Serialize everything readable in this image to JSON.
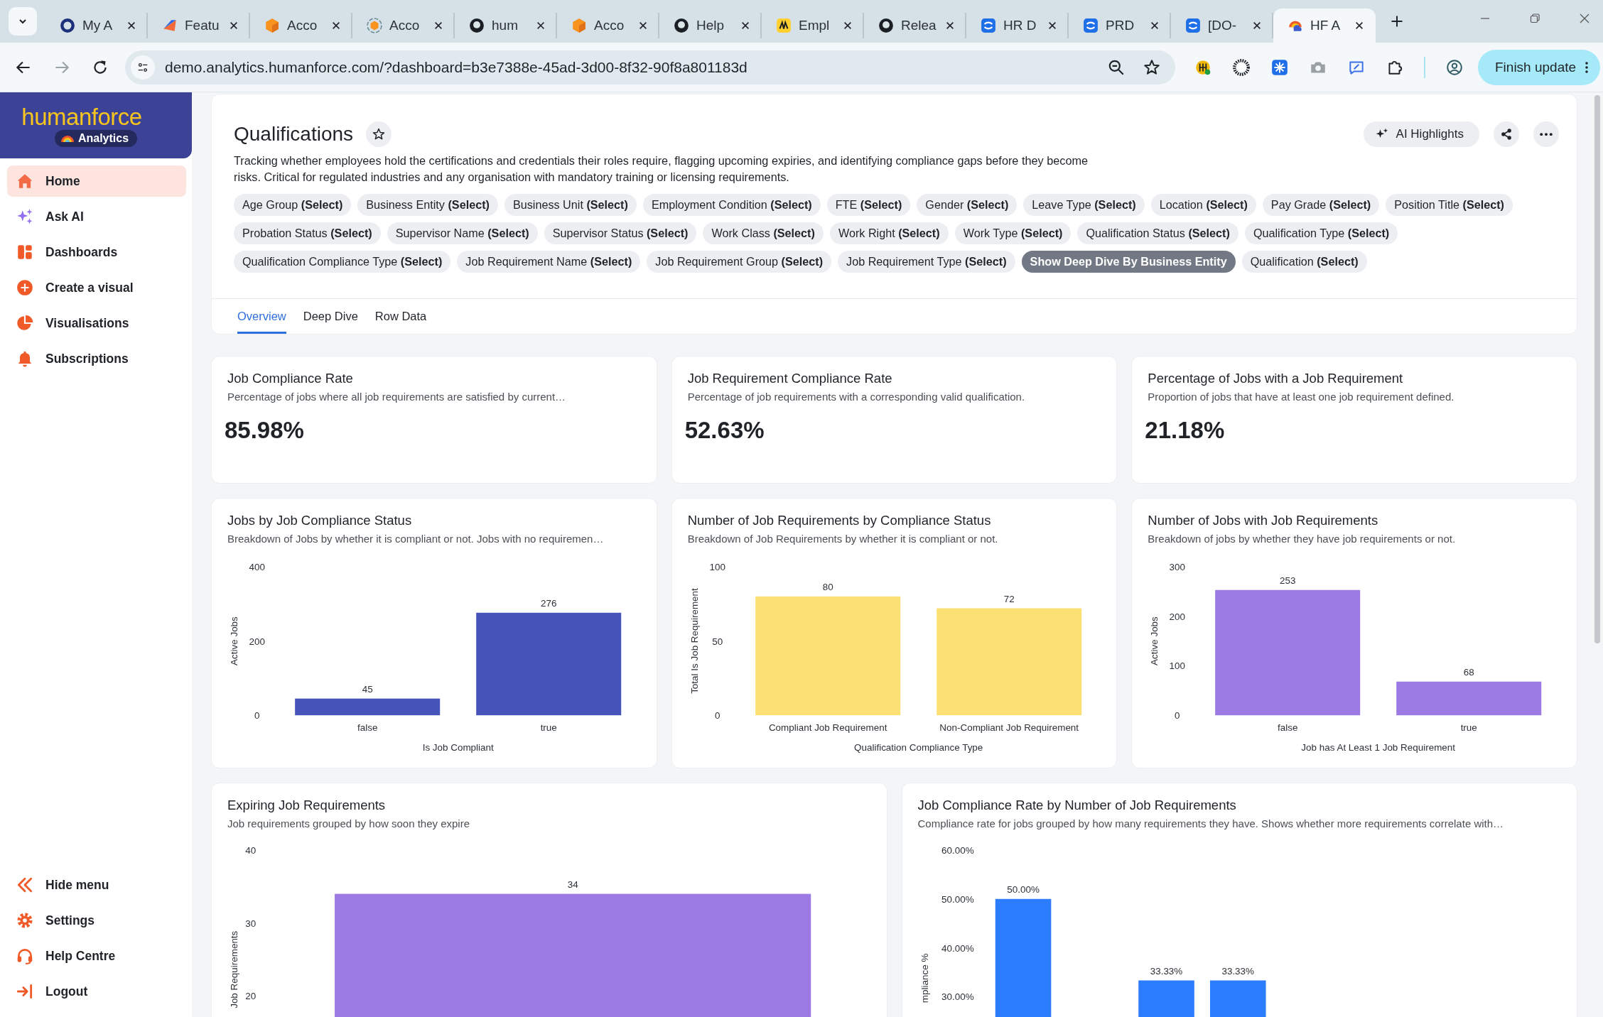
{
  "browser": {
    "tabs": [
      {
        "title": "My A",
        "selected": false
      },
      {
        "title": "Featu",
        "selected": false
      },
      {
        "title": "Acco",
        "selected": false
      },
      {
        "title": "Acco",
        "selected": false
      },
      {
        "title": "hum",
        "selected": false
      },
      {
        "title": "Acco",
        "selected": false
      },
      {
        "title": "Help",
        "selected": false
      },
      {
        "title": "Empl",
        "selected": false
      },
      {
        "title": "Relea",
        "selected": false
      },
      {
        "title": "HR D",
        "selected": false
      },
      {
        "title": "PRD",
        "selected": false
      },
      {
        "title": "[DO-",
        "selected": false
      },
      {
        "title": "HF A",
        "selected": true
      }
    ],
    "url": "demo.analytics.humanforce.com/?dashboard=b3e7388e-45ad-3d00-8f32-90f8a801183d",
    "update_button": "Finish update"
  },
  "sidebar": {
    "logo": {
      "wordmark": "humanforce",
      "badge": "Analytics"
    },
    "items": [
      {
        "label": "Home",
        "selected": true
      },
      {
        "label": "Ask AI",
        "selected": false
      },
      {
        "label": "Dashboards",
        "selected": false
      },
      {
        "label": "Create a visual",
        "selected": false
      },
      {
        "label": "Visualisations",
        "selected": false
      },
      {
        "label": "Subscriptions",
        "selected": false
      }
    ],
    "footer_items": [
      {
        "label": "Hide menu"
      },
      {
        "label": "Settings"
      },
      {
        "label": "Help Centre"
      },
      {
        "label": "Logout"
      }
    ]
  },
  "dashboard": {
    "title": "Qualifications",
    "description": "Tracking whether employees hold the certifications and credentials their roles require, flagging upcoming expiries, and identifying compliance gaps before they become risks. Critical for regulated industries and any organisation with mandatory training or licensing requirements.",
    "ai_button": "AI Highlights",
    "filter_rows": [
      [
        {
          "label": "Age Group **(Select)**",
          "selected": false
        },
        {
          "label": "Business Entity **(Select)**",
          "selected": false
        },
        {
          "label": "Business Unit **(Select)**",
          "selected": false
        },
        {
          "label": "Employment Condition **(Select)**",
          "selected": false
        },
        {
          "label": "FTE **(Select)**",
          "selected": false
        },
        {
          "label": "Gender **(Select)**",
          "selected": false
        },
        {
          "label": "Leave Type **(Select)**",
          "selected": false
        },
        {
          "label": "Location **(Select)**",
          "selected": false
        },
        {
          "label": "Pay Grade **(Select)**",
          "selected": false
        },
        {
          "label": "Position Title **(Select)**",
          "selected": false
        }
      ],
      [
        {
          "label": "Probation Status **(Select)**",
          "selected": false
        },
        {
          "label": "Supervisor Name **(Select)**",
          "selected": false
        },
        {
          "label": "Supervisor Status **(Select)**",
          "selected": false
        },
        {
          "label": "Work Class **(Select)**",
          "selected": false
        },
        {
          "label": "Work Right **(Select)**",
          "selected": false
        },
        {
          "label": "Work Type **(Select)**",
          "selected": false
        },
        {
          "label": "Qualification Status **(Select)**",
          "selected": false
        },
        {
          "label": "Qualification Type **(Select)**",
          "selected": false
        }
      ],
      [
        {
          "label": "Qualification Compliance Type **(Select)**",
          "selected": false
        },
        {
          "label": "Job Requirement Name **(Select)**",
          "selected": false
        },
        {
          "label": "Job Requirement Group **(Select)**",
          "selected": false
        },
        {
          "label": "Job Requirement Type **(Select)**",
          "selected": false
        },
        {
          "label": "Show Deep Dive By Business Entity",
          "selected": true
        },
        {
          "label": "Qualification **(Select)**",
          "selected": false
        }
      ]
    ],
    "tabs": [
      {
        "label": "Overview",
        "selected": true
      },
      {
        "label": "Deep Dive",
        "selected": false
      },
      {
        "label": "Row Data",
        "selected": false
      }
    ]
  },
  "kpis": [
    {
      "title": "Job Compliance Rate",
      "subtitle": "Percentage of jobs where all job requirements are satisfied by current…",
      "value": "85.98%"
    },
    {
      "title": "Job Requirement Compliance Rate",
      "subtitle": "Percentage of job requirements with a corresponding valid qualification.",
      "value": "52.63%"
    },
    {
      "title": "Percentage of Jobs with a Job Requirement",
      "subtitle": "Proportion of jobs that have at least one job requirement defined.",
      "value": "21.18%"
    }
  ],
  "charts": [
    {
      "title": "Jobs by Job Compliance Status",
      "subtitle": "Breakdown of Jobs by whether it is compliant or not. Jobs with no requiremen…",
      "chart_data": {
        "type": "bar",
        "xlabel": "Is Job Compliant",
        "ylabel": "Active Jobs",
        "categories": [
          "false",
          "true"
        ],
        "series": [
          {
            "color": "#4653b9",
            "values": [
              45,
              276
            ]
          }
        ],
        "ylim": [
          0,
          400
        ],
        "yticks": [
          0,
          200,
          400
        ],
        "data_labels": true
      }
    },
    {
      "title": "Number of Job Requirements by Compliance Status",
      "subtitle": "Breakdown of Job Requirements by whether it is compliant or not.",
      "chart_data": {
        "type": "bar",
        "xlabel": "Qualification Compliance Type",
        "ylabel": "Total Is Job Requirement",
        "categories": [
          "Compliant Job Requirement",
          "Non-Compliant Job Requirement"
        ],
        "series": [
          {
            "color": "#fde073",
            "values": [
              80,
              72
            ]
          }
        ],
        "ylim": [
          0,
          100
        ],
        "yticks": [
          0,
          50,
          100
        ],
        "data_labels": true
      }
    },
    {
      "title": "Number of Jobs with Job Requirements",
      "subtitle": "Breakdown of jobs by whether they have job requirements or not.",
      "chart_data": {
        "type": "bar",
        "xlabel": "Job has At Least 1 Job Requirement",
        "ylabel": "Active Jobs",
        "categories": [
          "false",
          "true"
        ],
        "series": [
          {
            "color": "#9b7be3",
            "values": [
              253,
              68
            ]
          }
        ],
        "ylim": [
          0,
          300
        ],
        "yticks": [
          0,
          100,
          200,
          300
        ],
        "data_labels": true
      }
    },
    {
      "title": "Expiring Job Requirements",
      "subtitle": "Job requirements grouped by how soon they expire",
      "chart_data": {
        "type": "bar",
        "ylabel": "Job Requirements",
        "categories": [
          null
        ],
        "series": [
          {
            "color": "#9b7be3",
            "values": [
              34
            ]
          }
        ],
        "ylim": [
          0,
          40
        ],
        "yticks": [
          20,
          30,
          40
        ],
        "data_labels": true
      }
    },
    {
      "title": "Job Compliance Rate by Number of Job Requirements",
      "subtitle": "Compliance rate for jobs grouped by how many requirements they have. Shows whether more requirements correlate with…",
      "chart_data": {
        "type": "bar",
        "ylabel": "mpliance %",
        "categories": [
          null,
          null,
          null
        ],
        "series": [
          {
            "color": "#2b7cff",
            "values": [
              50,
              33.33,
              33.33
            ]
          }
        ],
        "ylim": [
          0,
          60
        ],
        "yticks": [
          {
            "value": 30,
            "label": "30.00%"
          },
          {
            "value": 40,
            "label": "40.00%"
          },
          {
            "value": 50,
            "label": "50.00%"
          },
          {
            "value": 60,
            "label": "60.00%"
          }
        ],
        "value_labels": [
          "50.00%",
          "33.33%",
          "33.33%"
        ]
      }
    }
  ]
}
